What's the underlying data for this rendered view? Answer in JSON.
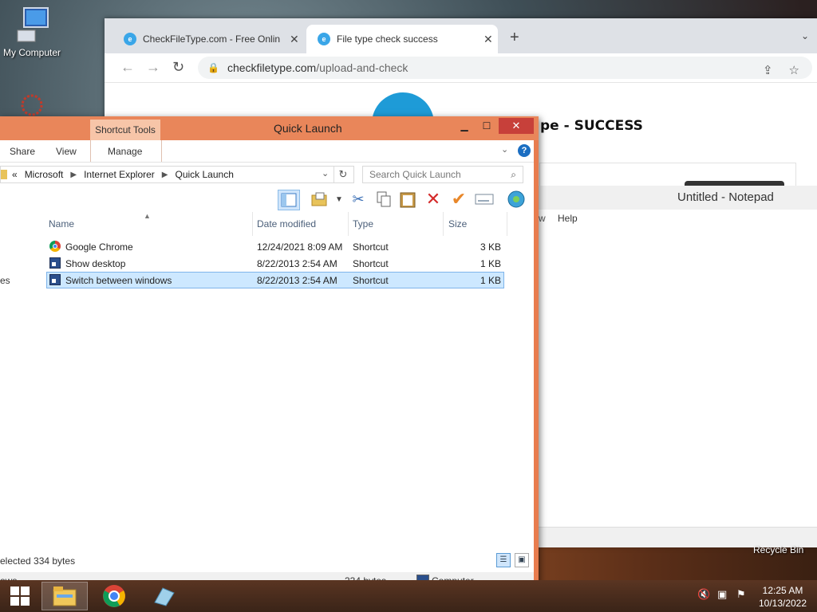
{
  "desktop": {
    "icons": [
      {
        "label": "My Computer",
        "icon": "computer-icon"
      },
      {
        "label": "",
        "icon": "app-icon"
      }
    ],
    "recycle_bin_label": "Recycle Bin"
  },
  "browser": {
    "tabs": [
      {
        "title": "CheckFileType.com - Free Online",
        "active": false
      },
      {
        "title": "File type check success",
        "active": true
      }
    ],
    "new_tab": "+",
    "url_host": "checkfiletype.com",
    "url_path": "/upload-and-check",
    "page_heading": "pe - SUCCESS"
  },
  "notepad": {
    "title": "Untitled - Notepad",
    "menu_partial": "w",
    "menu_help": "Help"
  },
  "explorer": {
    "context_tab": "Shortcut Tools",
    "title": "Quick Launch",
    "ribbon_tabs": [
      "Share",
      "View",
      "Manage"
    ],
    "breadcrumb": [
      "Microsoft",
      "Internet Explorer",
      "Quick Launch"
    ],
    "breadcrumb_prefix": "«",
    "search_placeholder": "Search Quick Launch",
    "columns": [
      "Name",
      "Date modified",
      "Type",
      "Size"
    ],
    "files": [
      {
        "name": "Google Chrome",
        "date": "12/24/2021 8:09 AM",
        "type": "Shortcut",
        "size": "3 KB",
        "icon": "chrome-icon",
        "selected": false
      },
      {
        "name": "Show desktop",
        "date": "8/22/2013 2:54 AM",
        "type": "Shortcut",
        "size": "1 KB",
        "icon": "shortcut-icon",
        "selected": false
      },
      {
        "name": "Switch between windows",
        "date": "8/22/2013 2:54 AM",
        "type": "Shortcut",
        "size": "1 KB",
        "icon": "shortcut-icon",
        "selected": true
      }
    ],
    "left_pane_partial": "es",
    "status_selected": "elected  334 bytes",
    "bottom_left": "ows",
    "bottom_size": "334 bytes",
    "bottom_location": "Computer"
  },
  "taskbar": {
    "clock_time": "12:25 AM",
    "clock_date": "10/13/2022"
  },
  "colors": {
    "explorer_frame": "#e87c4e",
    "close_button": "#c7403a",
    "selection": "#cde8ff"
  }
}
